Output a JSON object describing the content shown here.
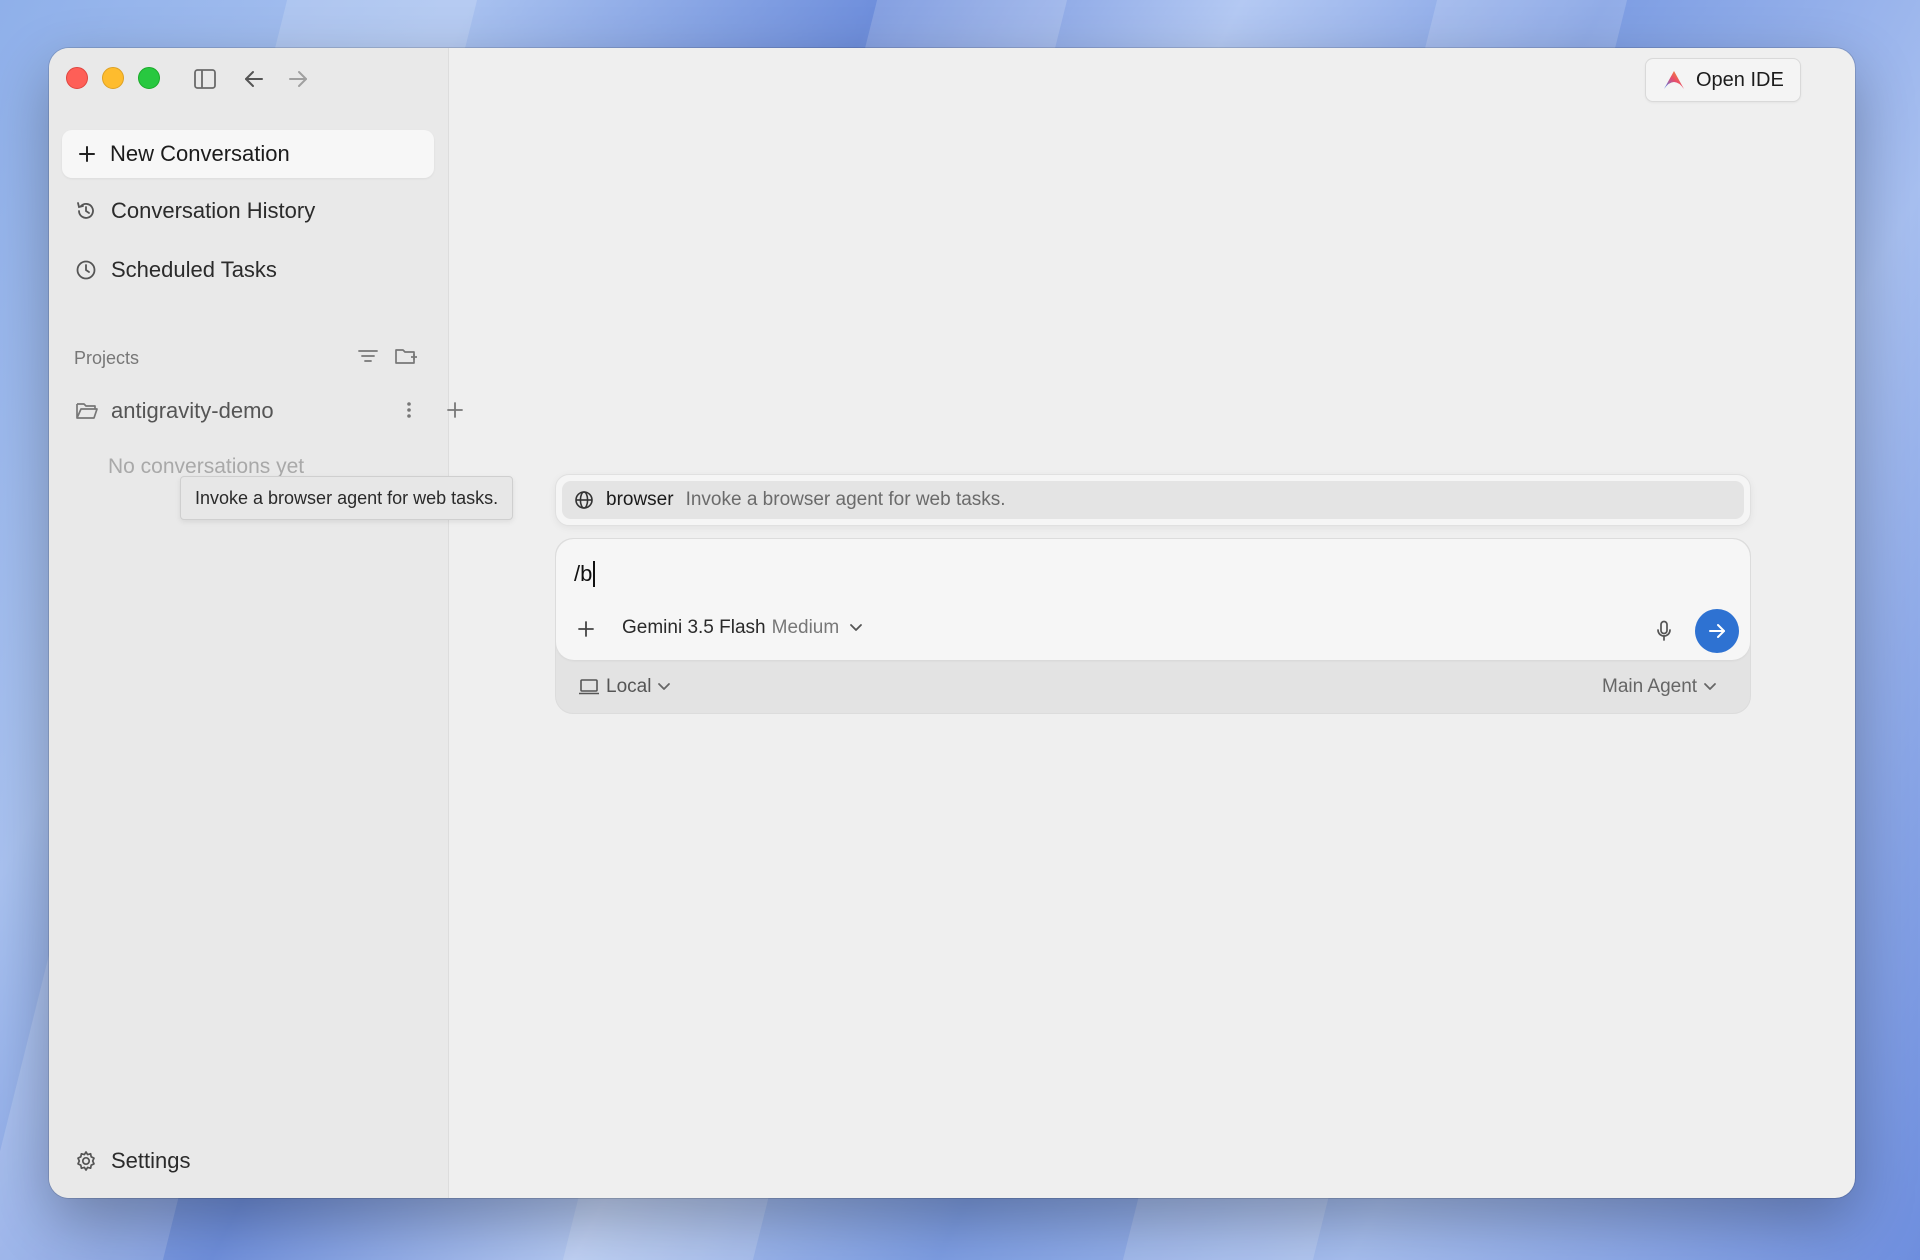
{
  "window": {
    "nav_back": "back",
    "nav_forward": "forward"
  },
  "sidebar": {
    "new_conversation": "New Conversation",
    "items": [
      {
        "label": "Conversation History",
        "icon": "history-icon"
      },
      {
        "label": "Scheduled Tasks",
        "icon": "clock-icon"
      }
    ],
    "projects_label": "Projects",
    "project": {
      "name": "antigravity-demo",
      "empty": "No conversations yet"
    },
    "settings_label": "Settings"
  },
  "tooltip": {
    "text": "Invoke a browser agent for web tasks."
  },
  "header": {
    "open_ide": "Open IDE"
  },
  "suggestion": {
    "name": "browser",
    "description": "Invoke a browser agent for web tasks."
  },
  "composer": {
    "value": "/b",
    "model": {
      "name": "Gemini 3.5 Flash",
      "level": "Medium"
    },
    "environment": "Local",
    "agent": "Main Agent"
  },
  "colors": {
    "send_button": "#2e72d2",
    "accent_red": "#fe5f57",
    "accent_yellow": "#febc2e",
    "accent_green": "#28c840"
  }
}
